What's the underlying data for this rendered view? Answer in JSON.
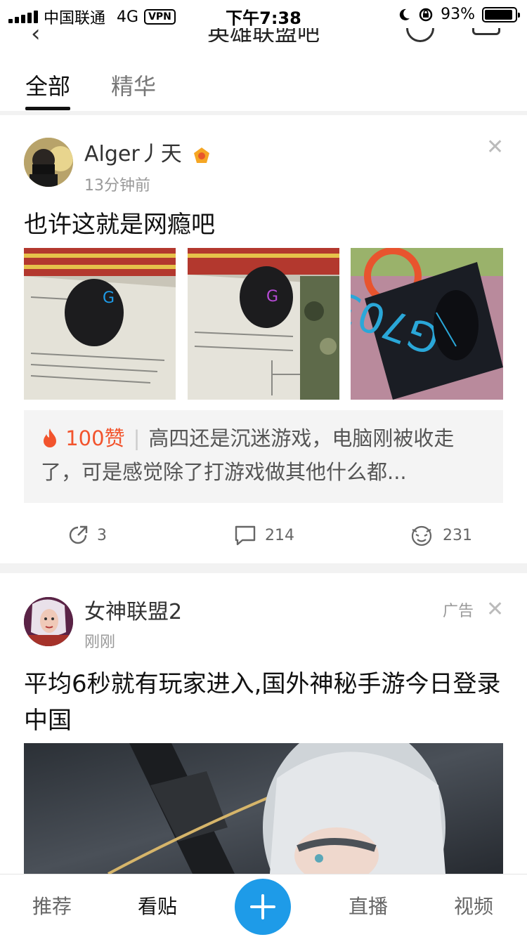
{
  "status_bar": {
    "carrier": "中国联通",
    "network": "4G",
    "vpn": "VPN",
    "time": "下午7:38",
    "battery_percent": "93%"
  },
  "header": {
    "title": "英雄联盟吧"
  },
  "tabs": [
    {
      "label": "全部",
      "active": true
    },
    {
      "label": "精华",
      "active": false
    }
  ],
  "posts": [
    {
      "author": "Alger丿天",
      "time": "13分钟前",
      "title": "也许这就是网瘾吧",
      "hot_comment": {
        "likes": "100赞",
        "text": "高四还是沉迷游戏，电脑刚被收走了，可是感觉除了打游戏做其他什么都..."
      },
      "actions": {
        "share_count": "3",
        "comment_count": "214",
        "like_count": "231"
      }
    },
    {
      "author": "女神联盟2",
      "time": "刚刚",
      "ad_label": "广告",
      "title": "平均6秒就有玩家进入,国外神秘手游今日登录中国"
    }
  ],
  "bottom_nav": {
    "items": [
      {
        "label": "推荐",
        "active": false
      },
      {
        "label": "看贴",
        "active": true
      },
      {
        "label": "直播",
        "active": false
      },
      {
        "label": "视频",
        "active": false
      }
    ]
  },
  "colors": {
    "accent": "#1e9be8",
    "hot": "#f2542d"
  }
}
